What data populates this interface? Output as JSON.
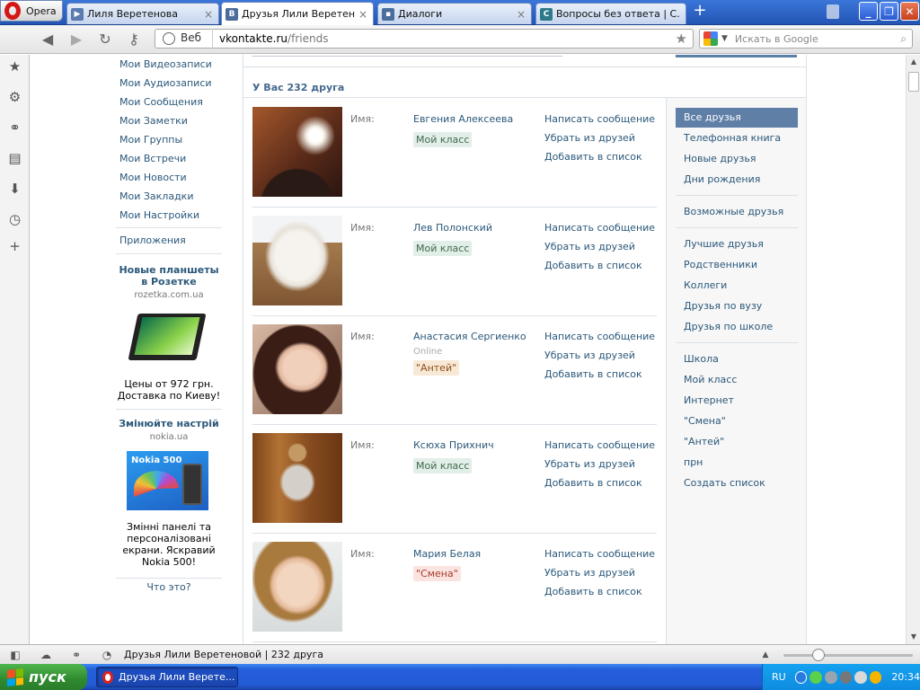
{
  "browser": {
    "menu_label": "Opera",
    "tabs": [
      {
        "title": "Лиля Веретенова",
        "favicon": "play",
        "color": "#5a7ab0"
      },
      {
        "title": "Друзья Лили Веретено...",
        "favicon": "В",
        "color": "#4b6d9c"
      },
      {
        "title": "Диалоги",
        "favicon": "chat",
        "color": "#4b6d9c"
      },
      {
        "title": "Вопросы без ответа | С...",
        "favicon": "C",
        "color": "#2e7a8a"
      }
    ],
    "address": {
      "scheme_label": "Веб",
      "host": "vkontakte.ru",
      "path": "/friends"
    },
    "search_placeholder": "Искать в Google",
    "status_text": "Друзья Лили Веретеновой | 232 друга"
  },
  "left_menu": {
    "items": [
      "Мои Видеозаписи",
      "Мои Аудиозаписи",
      "Мои Сообщения",
      "Мои Заметки",
      "Мои Группы",
      "Мои Встречи",
      "Мои Новости",
      "Мои Закладки",
      "Мои Настройки"
    ],
    "apps": "Приложения",
    "ad1": {
      "title": "Новые планшеты в Розетке",
      "domain": "rozetka.com.ua",
      "text": "Цены от 972 грн. Доставка по Киеву!"
    },
    "ad2": {
      "title": "Змінюйте настрій",
      "domain": "nokia.ua",
      "image_brand": "Nokia 500",
      "text": "Змінні панелі та персоналізовані екрани. Яскравий Nokia 500!"
    },
    "what_is_this": "Что это?"
  },
  "friends": {
    "count_label": "У Вас 232 друга",
    "name_label": "Имя:",
    "actions": [
      "Написать сообщение",
      "Убрать из друзей",
      "Добавить в список"
    ],
    "list": [
      {
        "name": "Евгения Алексеева",
        "status": "",
        "badge": "Мой класс",
        "badge_color": "green"
      },
      {
        "name": "Лев Полонский",
        "status": "",
        "badge": "Мой класс",
        "badge_color": "green"
      },
      {
        "name": "Анастасия Сергиенко",
        "status": "Online",
        "badge": "\"Антей\"",
        "badge_color": "orange"
      },
      {
        "name": "Ксюха Прихнич",
        "status": "",
        "badge": "Мой класс",
        "badge_color": "green"
      },
      {
        "name": "Мария Белая",
        "status": "",
        "badge": "\"Смена\"",
        "badge_color": "red"
      }
    ]
  },
  "filters": {
    "group1": [
      "Все друзья",
      "Телефонная книга",
      "Новые друзья",
      "Дни рождения"
    ],
    "group2": [
      "Возможные друзья"
    ],
    "group3": [
      "Лучшие друзья",
      "Родственники",
      "Коллеги",
      "Друзья по вузу",
      "Друзья по школе"
    ],
    "group4": [
      "Школа",
      "Мой класс",
      "Интернет",
      "\"Смена\"",
      "\"Антей\"",
      "прн",
      "Создать список"
    ],
    "active": "Все друзья"
  },
  "taskbar": {
    "start_label": "пуск",
    "window_title": "Друзья Лили Верете...",
    "language": "RU",
    "clock": "20:34"
  },
  "colors": {
    "vk_link": "#2b587a",
    "vk_header": "#45688e",
    "vk_selected": "#5f7fa6",
    "xp_taskbar": "#245edb"
  }
}
